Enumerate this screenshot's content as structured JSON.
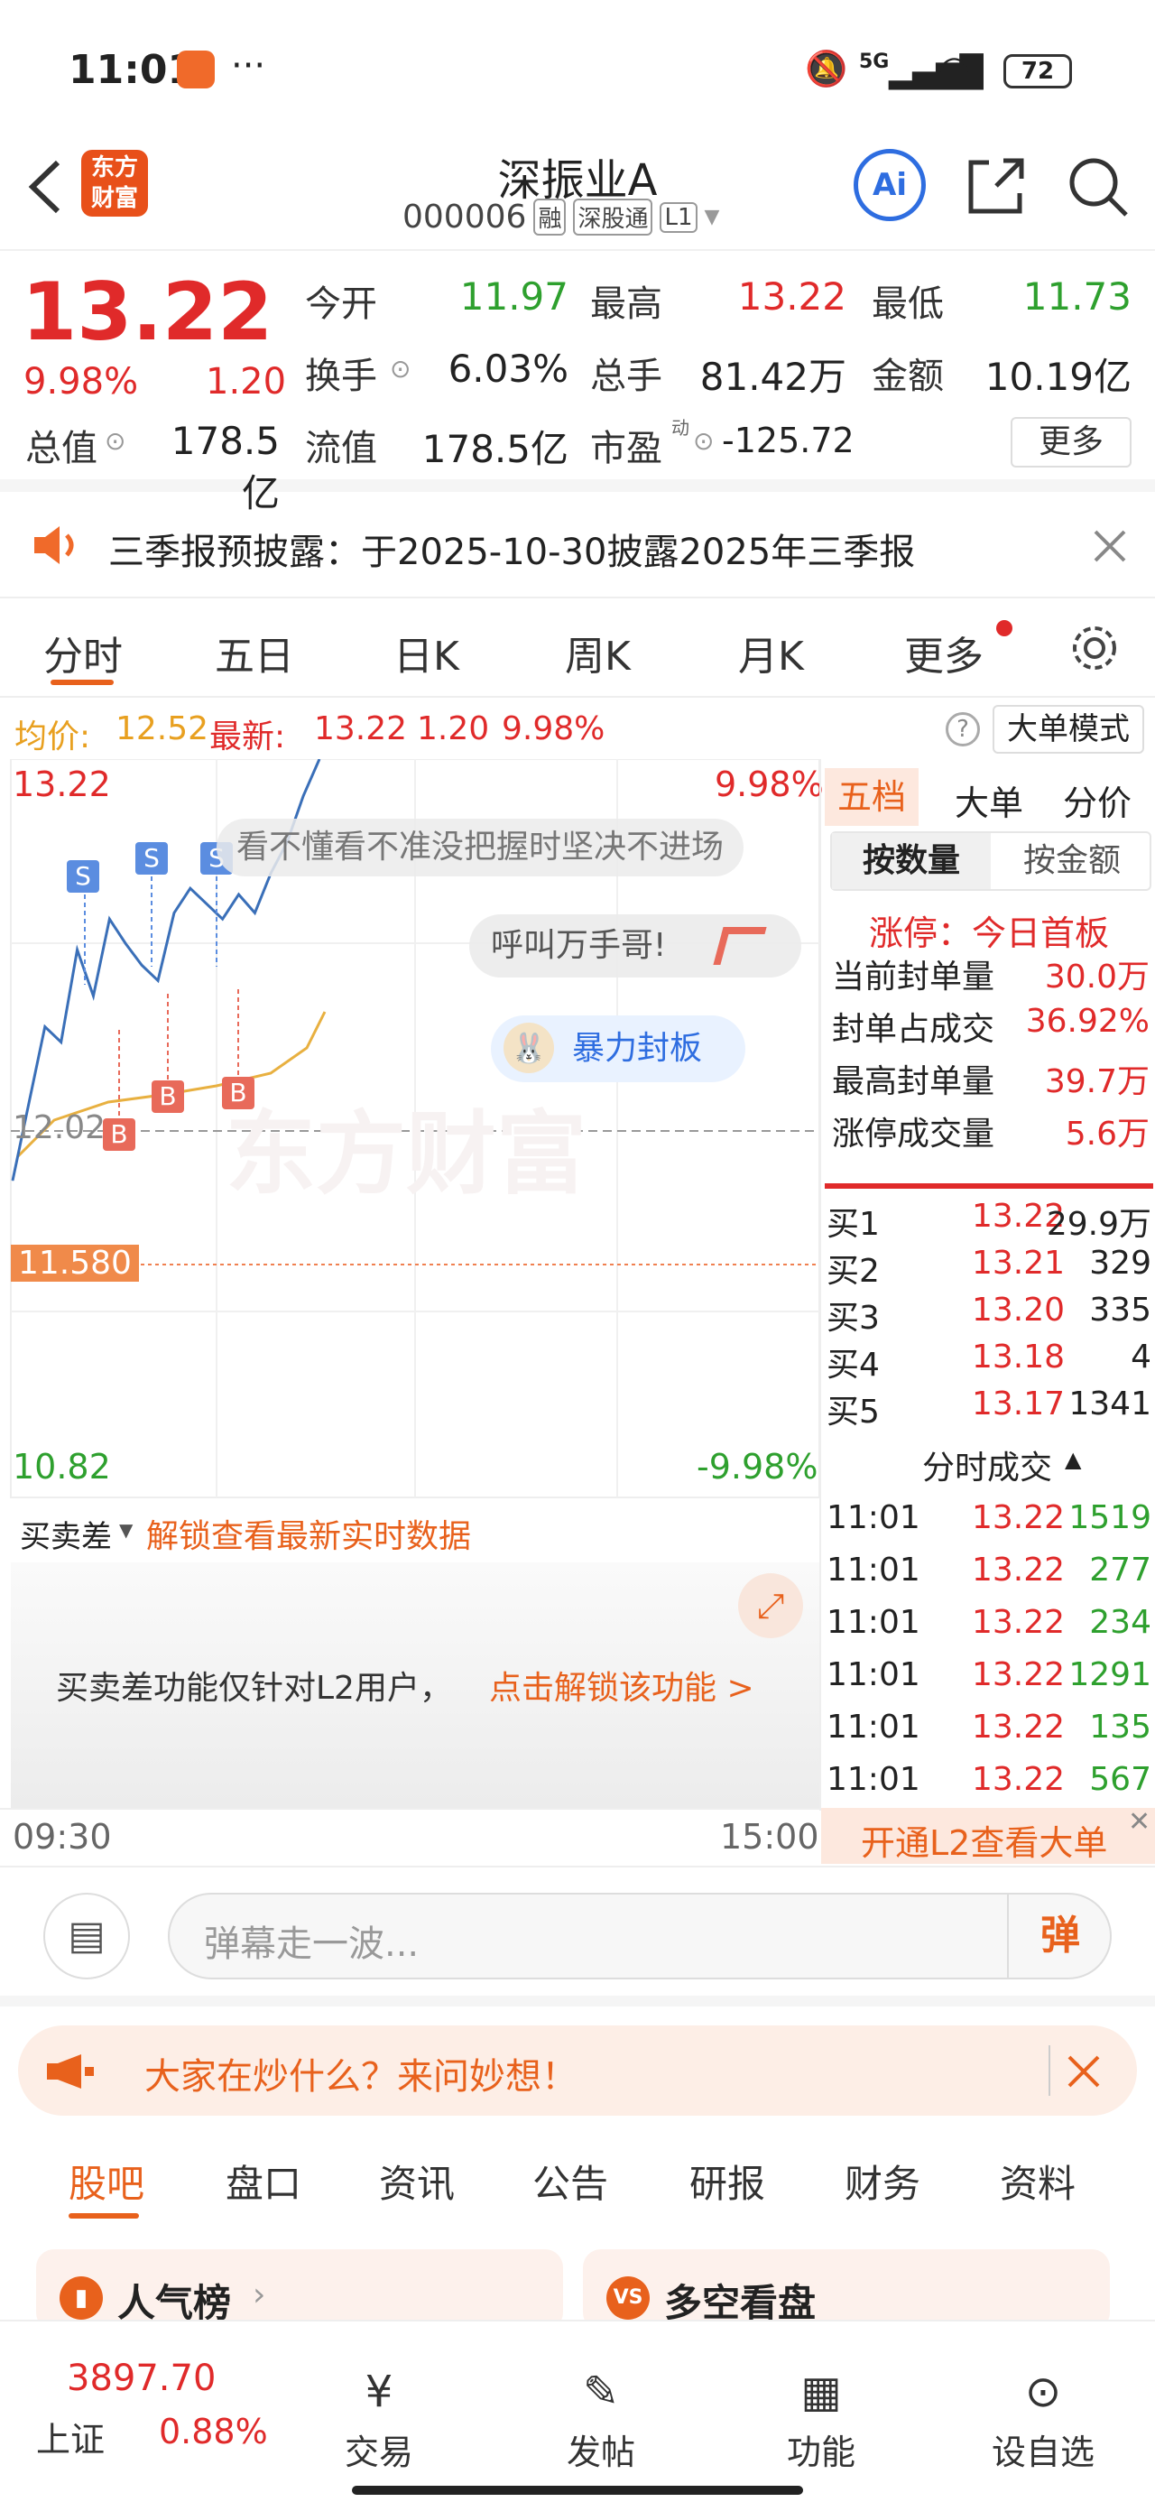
{
  "status": {
    "time": "11:01",
    "dots": "···",
    "battery": "72",
    "net": "5G"
  },
  "header": {
    "brand_line1": "东方",
    "brand_line2": "财富",
    "stock_name": "深振业A",
    "stock_code": "000006",
    "tags": [
      "融",
      "深股通",
      "L1"
    ]
  },
  "quote": {
    "price": "13.22",
    "pct": "9.98%",
    "chg": "1.20",
    "open_label": "今开",
    "open": "11.97",
    "high_label": "最高",
    "high": "13.22",
    "low_label": "最低",
    "low": "11.73",
    "turn_label": "换手",
    "turn": "6.03%",
    "vol_label": "总手",
    "vol": "81.42万",
    "amt_label": "金额",
    "amt": "10.19亿",
    "mcap_label": "总值",
    "mcap": "178.5亿",
    "float_label": "流值",
    "float": "178.5亿",
    "pe_label": "市盈",
    "pe_sup": "动",
    "pe": "-125.72",
    "more": "更多"
  },
  "banner": {
    "text": "三季报预披露：于2025-10-30披露2025年三季报"
  },
  "tabs": [
    "分时",
    "五日",
    "日K",
    "周K",
    "月K",
    "更多"
  ],
  "info": {
    "avg_label": "均价:",
    "avg": "12.52",
    "last_label": "最新:",
    "last": "13.22",
    "chg": "1.20",
    "pct": "9.98%",
    "mode": "大单模式"
  },
  "chart": {
    "top_price": "13.22",
    "top_pct": "9.98%",
    "mid": "12.02",
    "cost": "11.580",
    "bot_price": "10.82",
    "bot_pct": "-9.98%",
    "tip1": "看不懂看不准没把握时坚决不进场",
    "tip2": "呼叫万手哥!",
    "tip3": "暴力封板",
    "start": "09:30",
    "end": "15:00",
    "s_mark": "S",
    "b_mark": "B",
    "watermark": "东方财富"
  },
  "chart_data": {
    "type": "line",
    "x_range": [
      "09:30",
      "15:00"
    ],
    "ylim": [
      10.82,
      13.22
    ],
    "ref": 12.02,
    "series": [
      {
        "values": [
          11.85,
          12.1,
          12.35,
          12.3,
          12.6,
          12.45,
          12.7,
          12.62,
          12.55,
          12.5,
          12.72,
          12.8,
          12.75,
          12.7,
          12.78,
          12.72,
          12.85,
          12.95,
          13.1,
          13.22
        ]
      }
    ]
  },
  "spread": {
    "label": "买卖差",
    "link": "解锁查看最新实时数据",
    "msg": "买卖差功能仅针对L2用户，",
    "unlock": "点击解锁该功能 >"
  },
  "panel": {
    "tabs": [
      "五档",
      "大单",
      "分价"
    ],
    "sub": [
      "按数量",
      "按金额"
    ],
    "limit_title": "涨停：今日首板",
    "stats": [
      {
        "k": "当前封单量",
        "v": "30.0万"
      },
      {
        "k": "封单占成交",
        "v": "36.92%"
      },
      {
        "k": "最高封单量",
        "v": "39.7万"
      },
      {
        "k": "涨停成交量",
        "v": "5.6万"
      }
    ],
    "bids": [
      {
        "k": "买1",
        "p": "13.22",
        "v": "29.9万"
      },
      {
        "k": "买2",
        "p": "13.21",
        "v": "329"
      },
      {
        "k": "买3",
        "p": "13.20",
        "v": "335"
      },
      {
        "k": "买4",
        "p": "13.18",
        "v": "4"
      },
      {
        "k": "买5",
        "p": "13.17",
        "v": "1341"
      }
    ],
    "ticks_title": "分时成交",
    "ticks": [
      {
        "t": "11:01",
        "p": "13.22",
        "v": "1519"
      },
      {
        "t": "11:01",
        "p": "13.22",
        "v": "277"
      },
      {
        "t": "11:01",
        "p": "13.22",
        "v": "234"
      },
      {
        "t": "11:01",
        "p": "13.22",
        "v": "1291"
      },
      {
        "t": "11:01",
        "p": "13.22",
        "v": "135"
      },
      {
        "t": "11:01",
        "p": "13.22",
        "v": "567"
      }
    ],
    "l2": "开通L2查看大单"
  },
  "danmu": {
    "placeholder": "弹幕走一波...",
    "btn": "弹"
  },
  "ask": {
    "text": "大家在炒什么？来问妙想！"
  },
  "subtabs": [
    "股吧",
    "盘口",
    "资讯",
    "公告",
    "研报",
    "财务",
    "资料"
  ],
  "cards": {
    "left": "人气榜",
    "right": "多空看盘"
  },
  "bottom": {
    "index_val": "3897.70",
    "index_name": "上证",
    "index_pct": "0.88%",
    "items": [
      "交易",
      "发帖",
      "功能",
      "设自选"
    ]
  }
}
